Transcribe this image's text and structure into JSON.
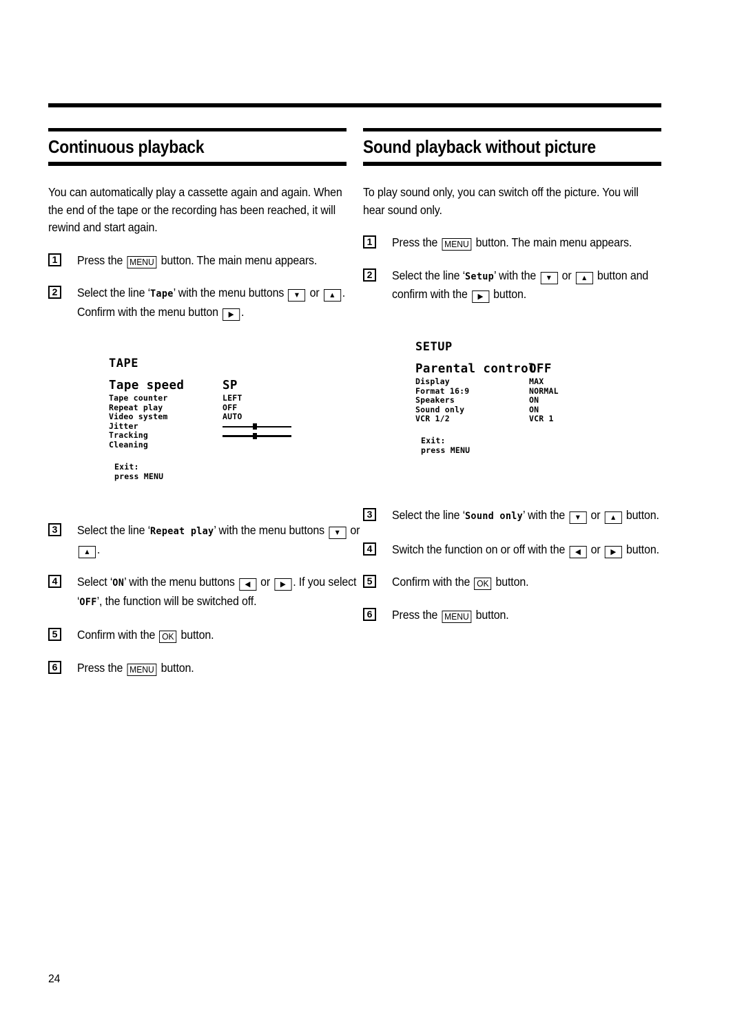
{
  "page": {
    "number": "24"
  },
  "columns": {
    "left": {
      "title": "Continuous playback",
      "intro": "You can automatically play a cassette again and again. When the end of the tape or the recording has been reached, it will rewind and start again.",
      "steps": [
        {
          "num": "1",
          "parts": [
            {
              "t": "text",
              "v": "Press the "
            },
            {
              "t": "key",
              "v": "MENU"
            },
            {
              "t": "text",
              "v": " button. The main menu appears."
            }
          ]
        },
        {
          "num": "2",
          "parts": [
            {
              "t": "text",
              "v": "Select the line ‘"
            },
            {
              "t": "mono",
              "v": "Tape"
            },
            {
              "t": "text",
              "v": "’ with the menu buttons "
            },
            {
              "t": "key",
              "v": "▼"
            },
            {
              "t": "text",
              "v": " or "
            },
            {
              "t": "key",
              "v": "▲"
            },
            {
              "t": "text",
              "v": ". Confirm with the menu button "
            },
            {
              "t": "key",
              "v": "▶"
            },
            {
              "t": "text",
              "v": "."
            }
          ]
        },
        {
          "num": "3",
          "parts": [
            {
              "t": "text",
              "v": "Select the line ‘"
            },
            {
              "t": "mono",
              "v": "Repeat play"
            },
            {
              "t": "text",
              "v": "’ with the menu buttons "
            },
            {
              "t": "key",
              "v": "▼"
            },
            {
              "t": "text",
              "v": " or "
            },
            {
              "t": "key",
              "v": "▲"
            },
            {
              "t": "text",
              "v": "."
            }
          ]
        },
        {
          "num": "4",
          "parts": [
            {
              "t": "text",
              "v": "Select ‘"
            },
            {
              "t": "mono",
              "v": "ON"
            },
            {
              "t": "text",
              "v": "’ with the menu buttons "
            },
            {
              "t": "key",
              "v": "◀"
            },
            {
              "t": "text",
              "v": " or "
            },
            {
              "t": "key",
              "v": "▶"
            },
            {
              "t": "text",
              "v": ". If you select ‘"
            },
            {
              "t": "mono",
              "v": "OFF"
            },
            {
              "t": "text",
              "v": "’, the function will be switched off."
            }
          ]
        },
        {
          "num": "5",
          "parts": [
            {
              "t": "text",
              "v": "Confirm with the "
            },
            {
              "t": "key",
              "v": "OK"
            },
            {
              "t": "text",
              "v": " button."
            }
          ]
        },
        {
          "num": "6",
          "parts": [
            {
              "t": "text",
              "v": "Press the "
            },
            {
              "t": "key",
              "v": "MENU"
            },
            {
              "t": "text",
              "v": " button."
            }
          ]
        }
      ]
    },
    "right": {
      "title": "Sound playback without picture",
      "intro": "To play sound only, you can switch off the picture. You will hear sound only.",
      "steps": [
        {
          "num": "1",
          "parts": [
            {
              "t": "text",
              "v": "Press the "
            },
            {
              "t": "key",
              "v": "MENU"
            },
            {
              "t": "text",
              "v": " button. The main menu appears."
            }
          ]
        },
        {
          "num": "2",
          "parts": [
            {
              "t": "text",
              "v": "Select the line ‘"
            },
            {
              "t": "mono",
              "v": "Setup"
            },
            {
              "t": "text",
              "v": "’ with the "
            },
            {
              "t": "key",
              "v": "▼"
            },
            {
              "t": "text",
              "v": " or "
            },
            {
              "t": "key",
              "v": "▲"
            },
            {
              "t": "text",
              "v": " button and confirm with the "
            },
            {
              "t": "key",
              "v": "▶"
            },
            {
              "t": "text",
              "v": " button."
            }
          ]
        },
        {
          "num": "3",
          "parts": [
            {
              "t": "text",
              "v": "Select the line ‘"
            },
            {
              "t": "mono",
              "v": "Sound only"
            },
            {
              "t": "text",
              "v": "’ with the "
            },
            {
              "t": "key",
              "v": "▼"
            },
            {
              "t": "text",
              "v": " or "
            },
            {
              "t": "key",
              "v": "▲"
            },
            {
              "t": "text",
              "v": " button."
            }
          ]
        },
        {
          "num": "4",
          "parts": [
            {
              "t": "text",
              "v": "Switch the function on or off with the "
            },
            {
              "t": "key",
              "v": "◀"
            },
            {
              "t": "text",
              "v": " or "
            },
            {
              "t": "key",
              "v": "▶"
            },
            {
              "t": "text",
              "v": " button."
            }
          ]
        },
        {
          "num": "5",
          "parts": [
            {
              "t": "text",
              "v": "Confirm with the "
            },
            {
              "t": "key",
              "v": "OK"
            },
            {
              "t": "text",
              "v": " button."
            }
          ]
        },
        {
          "num": "6",
          "parts": [
            {
              "t": "text",
              "v": "Press the "
            },
            {
              "t": "key",
              "v": "MENU"
            },
            {
              "t": "text",
              "v": " button."
            }
          ]
        }
      ]
    }
  },
  "screens": {
    "tape": {
      "title": "TAPE",
      "rows": [
        {
          "label": "Tape speed",
          "value": "SP",
          "highlight": true,
          "widget": "text"
        },
        {
          "label": "Tape counter",
          "value": "LEFT",
          "highlight": false,
          "widget": "text"
        },
        {
          "label": "Repeat play",
          "value": "OFF",
          "highlight": false,
          "widget": "text"
        },
        {
          "label": "Video system",
          "value": "AUTO",
          "highlight": false,
          "widget": "text"
        },
        {
          "label": "Jitter",
          "value": "",
          "highlight": false,
          "widget": "slider"
        },
        {
          "label": "Tracking",
          "value": "",
          "highlight": false,
          "widget": "slider"
        },
        {
          "label": "Cleaning",
          "value": "",
          "highlight": false,
          "widget": "text"
        }
      ],
      "exit_line1": "Exit:",
      "exit_line2": "press MENU"
    },
    "setup": {
      "title": "SETUP",
      "rows": [
        {
          "label": "Parental control",
          "value": "OFF",
          "highlight": true,
          "widget": "text"
        },
        {
          "label": "Display",
          "value": "MAX",
          "highlight": false,
          "widget": "text"
        },
        {
          "label": "Format 16:9",
          "value": "NORMAL",
          "highlight": false,
          "widget": "text"
        },
        {
          "label": "Speakers",
          "value": "ON",
          "highlight": false,
          "widget": "text"
        },
        {
          "label": "Sound only",
          "value": "ON",
          "highlight": false,
          "widget": "text"
        },
        {
          "label": "VCR 1/2",
          "value": "VCR 1",
          "highlight": false,
          "widget": "text"
        }
      ],
      "exit_line1": "Exit:",
      "exit_line2": "press MENU"
    }
  }
}
